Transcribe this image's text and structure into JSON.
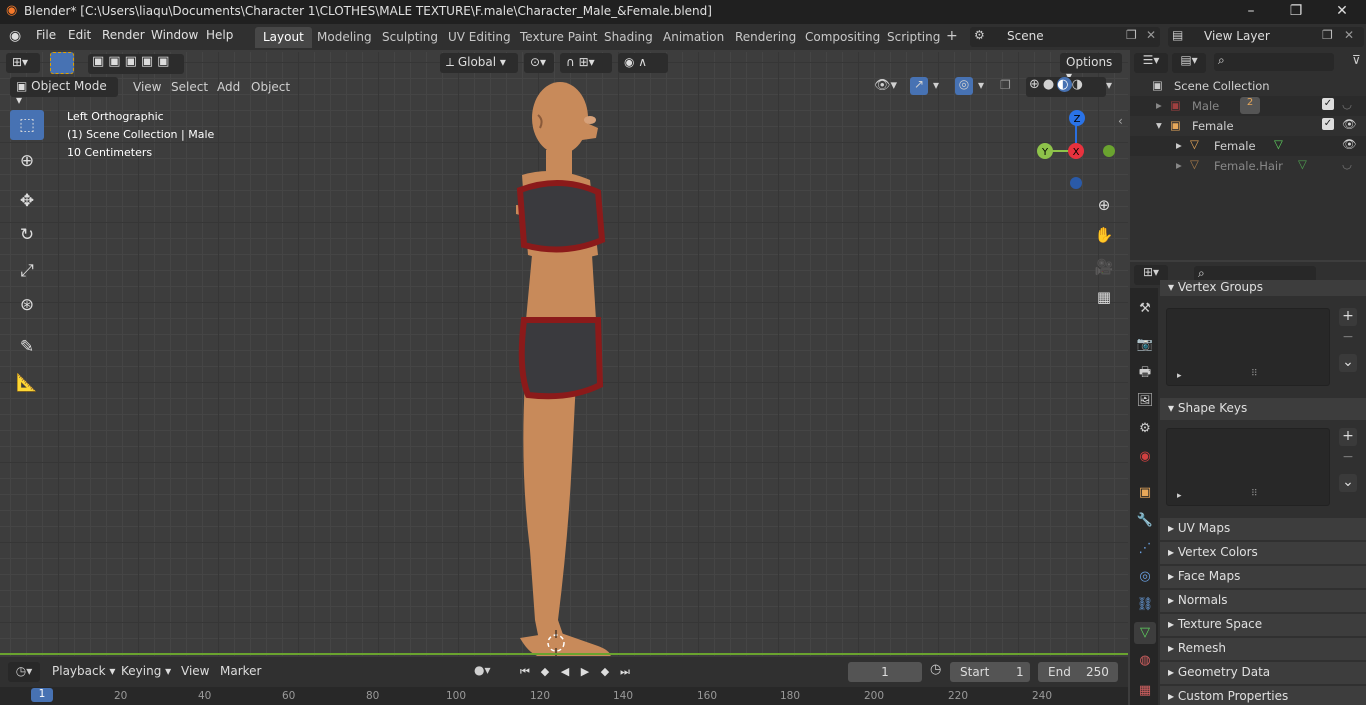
{
  "titlebar": {
    "title": "Blender* [C:\\Users\\liaqu\\Documents\\Character 1\\CLOTHES\\MALE TEXTURE\\F.male\\Character_Male_&Female.blend]",
    "min": "–",
    "max": "❐",
    "close": "✕"
  },
  "menubar": {
    "items": [
      "File",
      "Edit",
      "Render",
      "Window",
      "Help"
    ],
    "workspaces": [
      "Layout",
      "Modeling",
      "Sculpting",
      "UV Editing",
      "Texture Paint",
      "Shading",
      "Animation",
      "Rendering",
      "Compositing",
      "Scripting"
    ],
    "active_workspace": "Layout",
    "add_tab": "+",
    "scene": "Scene",
    "view_layer": "View Layer"
  },
  "viewport": {
    "transform_orientation": "Global",
    "options": "Options",
    "mode": "Object Mode",
    "header_menus": [
      "View",
      "Select",
      "Add",
      "Object"
    ],
    "info": {
      "view_name": "Left Orthographic",
      "collection": "(1) Scene Collection | Male",
      "scale": "10 Centimeters"
    },
    "gizmo": {
      "z": "Z",
      "y": "Y",
      "x": "X"
    },
    "accent": "#4772b3",
    "grid_color": "#454545"
  },
  "outliner": {
    "scene_collection": "Scene Collection",
    "rows": [
      {
        "label": "Male",
        "badge": "2",
        "hidden": true
      },
      {
        "label": "Female"
      },
      {
        "label": "Female"
      },
      {
        "label": "Female.Hair",
        "hidden": true
      }
    ]
  },
  "properties": {
    "panels": [
      {
        "label": "Vertex Groups",
        "open": true
      },
      {
        "label": "Shape Keys",
        "open": true
      },
      {
        "label": "UV Maps"
      },
      {
        "label": "Vertex Colors"
      },
      {
        "label": "Face Maps"
      },
      {
        "label": "Normals"
      },
      {
        "label": "Texture Space"
      },
      {
        "label": "Remesh"
      },
      {
        "label": "Geometry Data"
      },
      {
        "label": "Custom Properties"
      }
    ]
  },
  "timeline": {
    "menus": [
      "Playback",
      "Keying",
      "View",
      "Marker"
    ],
    "current_frame": "1",
    "start_label": "Start",
    "start": "1",
    "end_label": "End",
    "end": "250",
    "ticks": [
      "1",
      "20",
      "40",
      "60",
      "80",
      "100",
      "120",
      "140",
      "160",
      "180",
      "200",
      "220",
      "240"
    ]
  }
}
